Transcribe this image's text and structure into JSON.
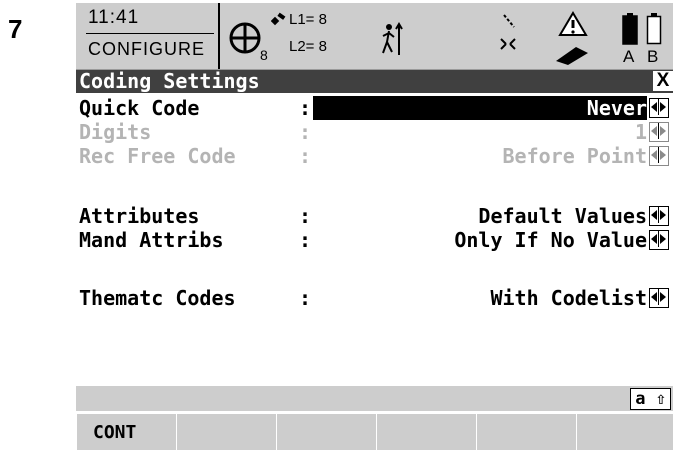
{
  "step": "7",
  "status": {
    "time": "11:41",
    "mode": "CONFIGURE",
    "satellites_used": "8",
    "l1": "L1= 8",
    "l2": "L2= 8",
    "battery_a": "A",
    "battery_b": "B"
  },
  "screen": {
    "title": "Coding Settings",
    "close": "X"
  },
  "fields": [
    {
      "label": "Quick Code",
      "colon": ":",
      "value": "Never",
      "state": "active"
    },
    {
      "label": "Digits",
      "colon": ":",
      "value": "1",
      "state": "disabled"
    },
    {
      "label": "Rec Free Code",
      "colon": ":",
      "value": "Before Point",
      "state": "disabled"
    },
    {
      "label": "Attributes",
      "colon": ":",
      "value": "Default Values",
      "state": "normal"
    },
    {
      "label": "Mand Attribs",
      "colon": ":",
      "value": "Only If No Value",
      "state": "normal"
    },
    {
      "label": "Thematc Codes",
      "colon": ":",
      "value": "With Codelist",
      "state": "normal"
    }
  ],
  "input_mode": "a ⇧",
  "softkeys": [
    "CONT",
    "",
    "",
    "",
    "",
    ""
  ],
  "icons": [
    "satellite-crosshair-icon",
    "signal-icon",
    "person-icon",
    "tilt-icon",
    "swap-icon",
    "warning-icon",
    "memory-card-icon",
    "battery-a-icon",
    "battery-b-icon"
  ]
}
